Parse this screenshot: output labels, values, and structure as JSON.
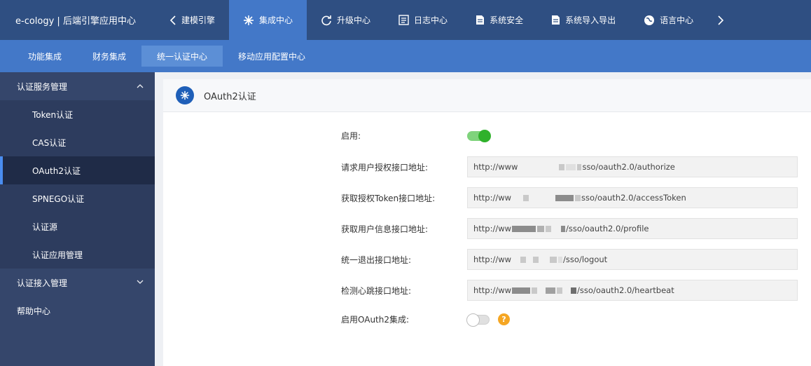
{
  "app": {
    "title": "e-cology | 后端引擎应用中心"
  },
  "top_tabs": [
    {
      "label": "建模引擎",
      "icon": "chevron-left-icon"
    },
    {
      "label": "集成中心",
      "icon": "snowflake-icon",
      "active": true
    },
    {
      "label": "升级中心",
      "icon": "refresh-icon"
    },
    {
      "label": "日志中心",
      "icon": "log-icon"
    },
    {
      "label": "系统安全",
      "icon": "document-icon"
    },
    {
      "label": "系统导入导出",
      "icon": "document-icon"
    },
    {
      "label": "语言中心",
      "icon": "globe-icon"
    }
  ],
  "sub_tabs": [
    {
      "label": "功能集成"
    },
    {
      "label": "财务集成"
    },
    {
      "label": "统一认证中心",
      "active": true
    },
    {
      "label": "移动应用配置中心"
    }
  ],
  "sidebar": {
    "group1": {
      "label": "认证服务管理",
      "expanded": true
    },
    "items": [
      {
        "label": "Token认证"
      },
      {
        "label": "CAS认证"
      },
      {
        "label": "OAuth2认证",
        "active": true
      },
      {
        "label": "SPNEGO认证"
      },
      {
        "label": "认证源"
      },
      {
        "label": "认证应用管理"
      }
    ],
    "group2": {
      "label": "认证接入管理"
    },
    "group3": {
      "label": "帮助中心"
    }
  },
  "panel": {
    "title": "OAuth2认证"
  },
  "form": {
    "enable_label": "启用:",
    "enable_value": true,
    "authorize_label": "请求用户授权接口地址:",
    "authorize_prefix": "http://www",
    "authorize_suffix": "sso/oauth2.0/authorize",
    "token_label": "获取授权Token接口地址:",
    "token_prefix": "http://ww",
    "token_suffix": "sso/oauth2.0/accessToken",
    "profile_label": "获取用户信息接口地址:",
    "profile_prefix": "http://ww",
    "profile_suffix": "/sso/oauth2.0/profile",
    "logout_label": "统一退出接口地址:",
    "logout_prefix": "http://ww",
    "logout_suffix": "/sso/logout",
    "heartbeat_label": "检测心跳接口地址:",
    "heartbeat_prefix": "http://ww",
    "heartbeat_suffix": "/sso/oauth2.0/heartbeat",
    "oauth2_label": "启用OAuth2集成:",
    "oauth2_value": false,
    "help_glyph": "?"
  },
  "colors": {
    "topbar": "#2f4f82",
    "accent": "#4378c8",
    "sidebar": "#35466b",
    "toggle_on": "#2fb12b",
    "help": "#f5a623"
  }
}
